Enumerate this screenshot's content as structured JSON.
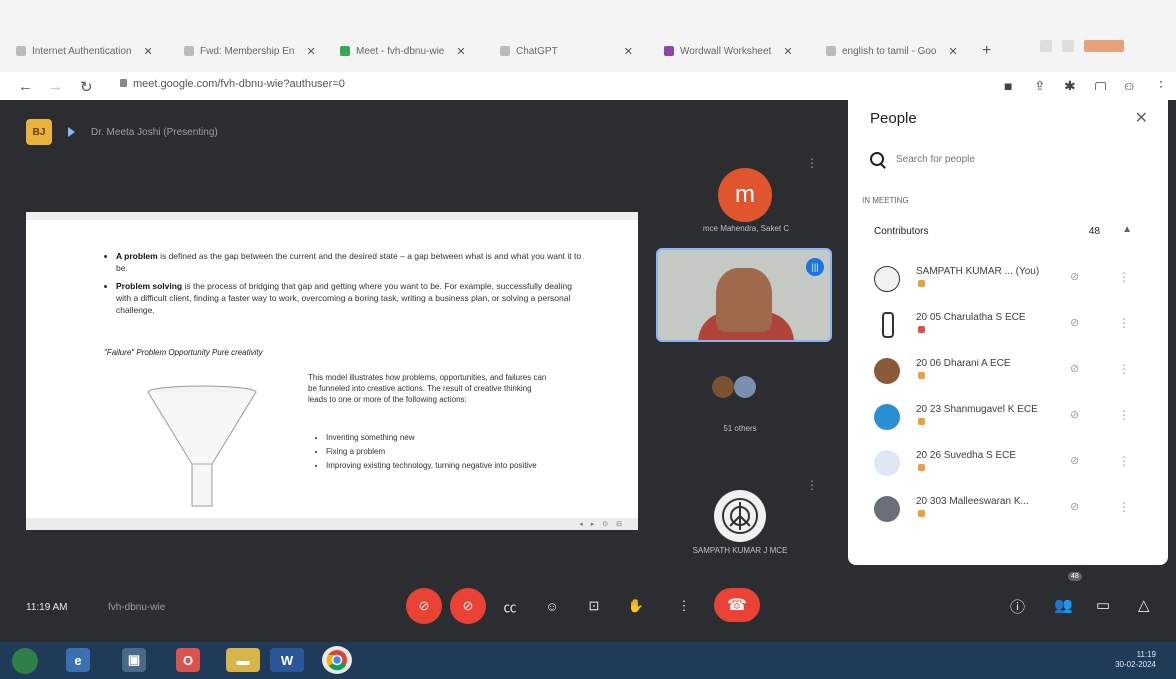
{
  "browser": {
    "tabs": [
      {
        "label": "Internet Authentication"
      },
      {
        "label": "Fwd: Membership En"
      },
      {
        "label": "Meet - fvh-dbnu-wie"
      },
      {
        "label": "ChatGPT"
      },
      {
        "label": "Wordwall Worksheet"
      },
      {
        "label": "english to tamil - Goo"
      }
    ],
    "url": "meet.google.com/fvh-dbnu-wie?authuser=0"
  },
  "meet": {
    "logo_text": "BJ",
    "presenting_label": "Dr. Meeta Joshi (Presenting)",
    "slide": {
      "bullet1_bold": "A problem",
      "bullet1_rest": " is defined as the gap between the current and the desired state – a gap between what is and what you want it to be.",
      "bullet2_bold": "Problem solving",
      "bullet2_rest": " is the process of bridging that gap and getting where you want to be. For example, successfully dealing with a difficult client, finding a faster way to work, overcoming a boring task, writing a business plan, or solving a personal challenge.",
      "model_line": "\"Failure\" Problem  Opportunity  Pure creativity",
      "model_desc": "This model illustrates how problems, opportunities, and failures can be funneled into creative actions. The result of creative thinking leads to one or more of the following actions:",
      "actions": [
        "Inventing something new",
        "Fixing a problem",
        "Improving existing technology, turning negative into positive"
      ]
    },
    "tiles": {
      "avatar_letter": "m",
      "avatar_name": "mce Mahendra, Saket C",
      "others_label": "51 others",
      "sampath_name": "SAMPATH KUMAR J MCE"
    },
    "clock": "11:19 AM",
    "meeting_code": "fvh-dbnu-wie"
  },
  "people_panel": {
    "title": "People",
    "search_placeholder": "Search for people",
    "in_meeting_label": "IN MEETING",
    "contributors_label": "Contributors",
    "contributors_count": "48",
    "participants": [
      {
        "name": "SAMPATH KUMAR ... (You)"
      },
      {
        "name": "20 05 Charulatha S ECE"
      },
      {
        "name": "20 06 Dharani A ECE"
      },
      {
        "name": "20 23 Shanmugavel K ECE"
      },
      {
        "name": "20 26 Suvedha S ECE"
      },
      {
        "name": "20 303 Malleeswaran K..."
      }
    ]
  },
  "taskbar": {
    "time": "11:19",
    "date": "30-02-2024",
    "word_label": "W"
  },
  "colors": {
    "meet_bg": "#2b2d31",
    "accent_red": "#ea4335",
    "raise_hand": "#e6a23c",
    "speaking_blue": "#1a73e8"
  }
}
